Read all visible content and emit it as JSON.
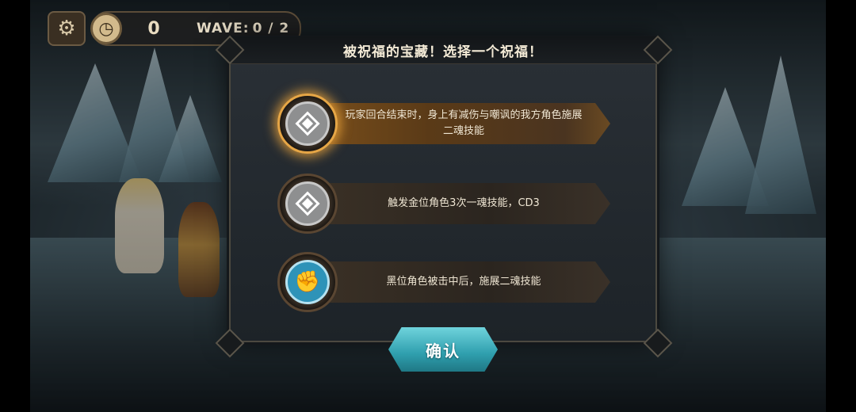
{
  "hud": {
    "settings_icon": "gear-icon",
    "timer_icon": "clock-icon",
    "count": "0",
    "wave_label": "WAVE:",
    "wave_value": "0 / 2"
  },
  "dialog": {
    "title": "被祝福的宝藏！选择一个祝福！",
    "options": [
      {
        "icon": "diamond-emblem-icon",
        "text": "玩家回合结束时，身上有减伤与嘲讽的我方角色施展二魂技能",
        "selected": true
      },
      {
        "icon": "diamond-emblem-icon",
        "text": "触发金位角色3次一魂技能，CD3",
        "selected": false
      },
      {
        "icon": "fist-emblem-icon",
        "text": "黑位角色被击中后，施展二魂技能",
        "selected": false
      }
    ],
    "confirm_label": "确认"
  },
  "colors": {
    "accent_selected": "#e6a646",
    "confirm": "#2f9fae",
    "title_text": "#f3ead6"
  }
}
